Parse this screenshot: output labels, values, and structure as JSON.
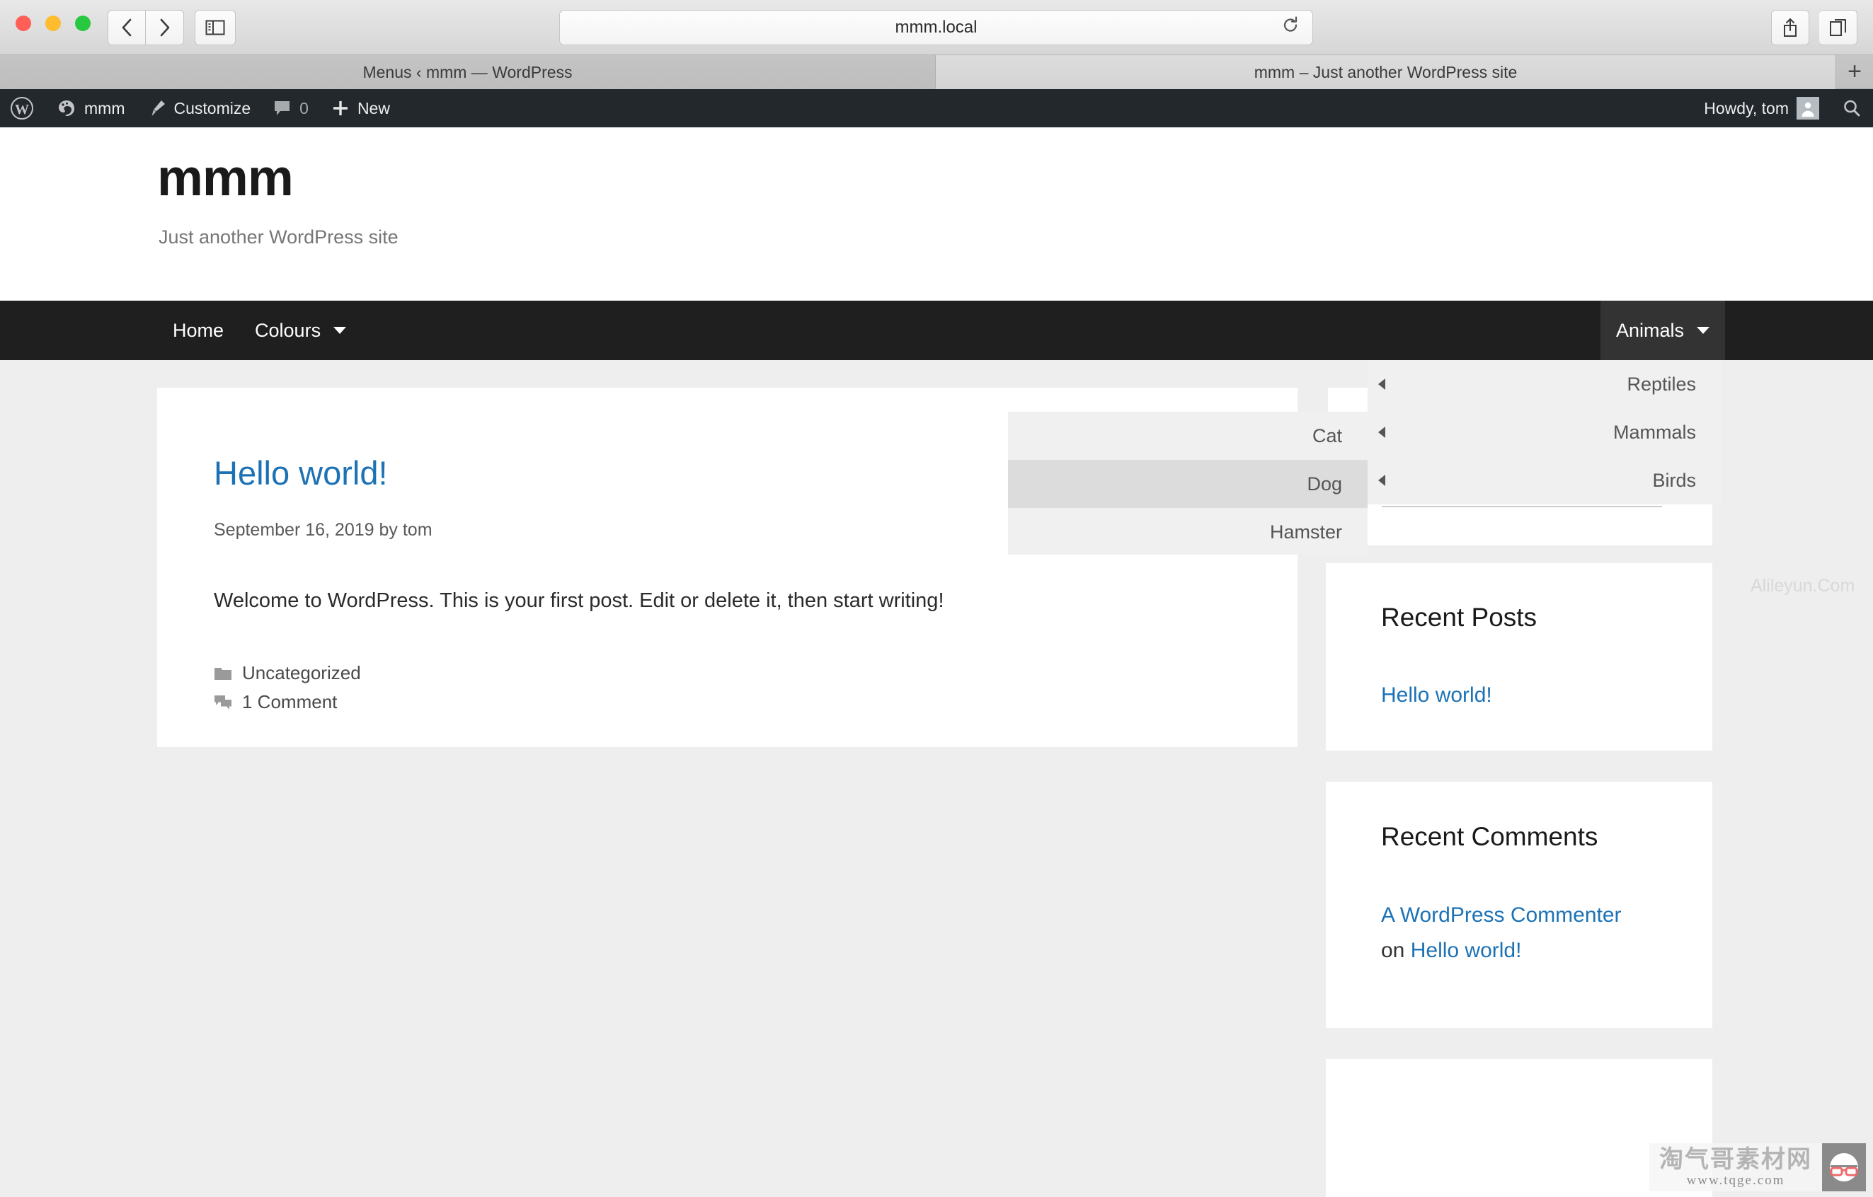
{
  "browser": {
    "url": "mmm.local",
    "tabs": [
      {
        "label": "Menus ‹ mmm — WordPress",
        "active": false
      },
      {
        "label": "mmm – Just another WordPress site",
        "active": true
      }
    ],
    "new_tab_label": "+",
    "back_icon": "chevron-left-icon",
    "forward_icon": "chevron-right-icon",
    "sidebar_icon": "sidebar-toggle-icon",
    "reload_icon": "reload-icon",
    "share_icon": "share-icon",
    "tabs_overview_icon": "tabs-overview-icon"
  },
  "adminbar": {
    "wp_logo_label": "wordpress-logo",
    "site_name": "mmm",
    "customize": "Customize",
    "comment_count": "0",
    "new": "New",
    "howdy": "Howdy, tom",
    "search_icon": "search-icon"
  },
  "site": {
    "title": "mmm",
    "description": "Just another WordPress site"
  },
  "nav": {
    "items": [
      {
        "label": "Home",
        "has_caret": false
      },
      {
        "label": "Colours",
        "has_caret": true
      }
    ],
    "right_item": {
      "label": "Animals",
      "has_caret": true
    }
  },
  "submenu_animals": {
    "items": [
      {
        "label": "Reptiles",
        "hover": false
      },
      {
        "label": "Mammals",
        "hover": false
      },
      {
        "label": "Birds",
        "hover": false
      }
    ]
  },
  "submenu_mammals": {
    "items": [
      {
        "label": "Cat",
        "hover": false
      },
      {
        "label": "Dog",
        "hover": true
      },
      {
        "label": "Hamster",
        "hover": false
      }
    ]
  },
  "post": {
    "title": "Hello world!",
    "meta": "September 16, 2019 by tom",
    "body": "Welcome to WordPress. This is your first post. Edit or delete it, then start writing!",
    "category": "Uncategorized",
    "comments": "1 Comment",
    "category_icon": "folder-icon",
    "comment_icon": "comments-icon"
  },
  "sidebar": {
    "recent_posts": {
      "title": "Recent Posts",
      "links": [
        "Hello world!"
      ]
    },
    "recent_comments": {
      "title": "Recent Comments",
      "author_link": "A WordPress Commenter",
      "connector": "on ",
      "post_link": "Hello world!"
    }
  },
  "watermarks": {
    "text": "Alileyun.Com",
    "logo_cn": "淘气哥素材网",
    "logo_url": "www.tqge.com"
  },
  "colors": {
    "admin_bar": "#23282d",
    "nav_bar": "#1f1f1f",
    "link": "#1c72b5",
    "page_bg": "#eeeeee",
    "submenu_bg": "#f0f0f0",
    "submenu_hover": "#dcdcdc"
  }
}
